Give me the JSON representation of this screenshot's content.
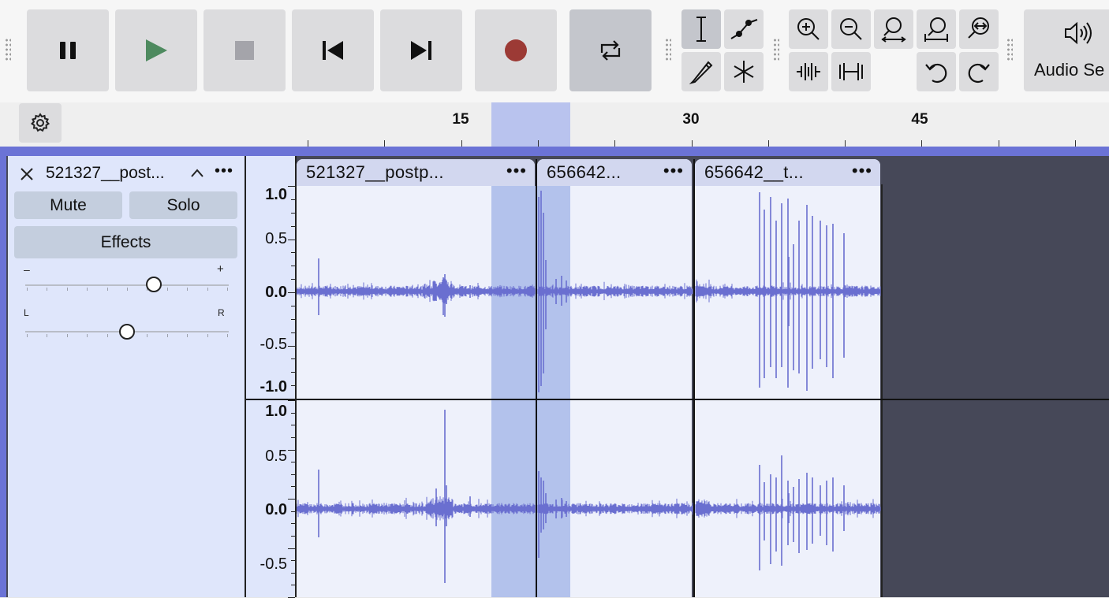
{
  "toolbar": {
    "transport": [
      {
        "name": "pause-button",
        "icon": "pause-icon"
      },
      {
        "name": "play-button",
        "icon": "play-icon"
      },
      {
        "name": "stop-button",
        "icon": "stop-icon"
      },
      {
        "name": "skip-to-start-button",
        "icon": "skip-start-icon"
      },
      {
        "name": "skip-to-end-button",
        "icon": "skip-end-icon"
      },
      {
        "name": "record-button",
        "icon": "record-icon"
      },
      {
        "name": "loop-button",
        "icon": "loop-icon"
      }
    ],
    "audio_setup_label": "Audio Se",
    "colors": {
      "play": "#4e8a5f",
      "record": "#9c3a35",
      "stop": "#a4a4aa"
    }
  },
  "ruler": {
    "ticks": [
      {
        "label": "15",
        "time": 15
      },
      {
        "label": "30",
        "time": 30
      },
      {
        "label": "45",
        "time": 45
      }
    ]
  },
  "track": {
    "name": "521327__post...",
    "mute_label": "Mute",
    "solo_label": "Solo",
    "effects_label": "Effects",
    "gain": {
      "min_label": "–",
      "max_label": "+",
      "value": 0.63
    },
    "pan": {
      "left_label": "L",
      "right_label": "R",
      "value": 0.5
    },
    "vertical_scale": {
      "channel1": [
        "1.0",
        "0.5",
        "0.0",
        "-0.5",
        "-1.0"
      ],
      "channel2": [
        "1.0",
        "0.5",
        "0.0",
        "-0.5"
      ]
    }
  },
  "clips": [
    {
      "name": "521327__postp...",
      "menu": "•••"
    },
    {
      "name": "656642...",
      "menu": "•••"
    },
    {
      "name": "656642__t...",
      "menu": "•••"
    }
  ],
  "colors": {
    "waveform": "#6a6fd0",
    "selection": "#b3c2ec",
    "track_border": "#6b73d6"
  }
}
